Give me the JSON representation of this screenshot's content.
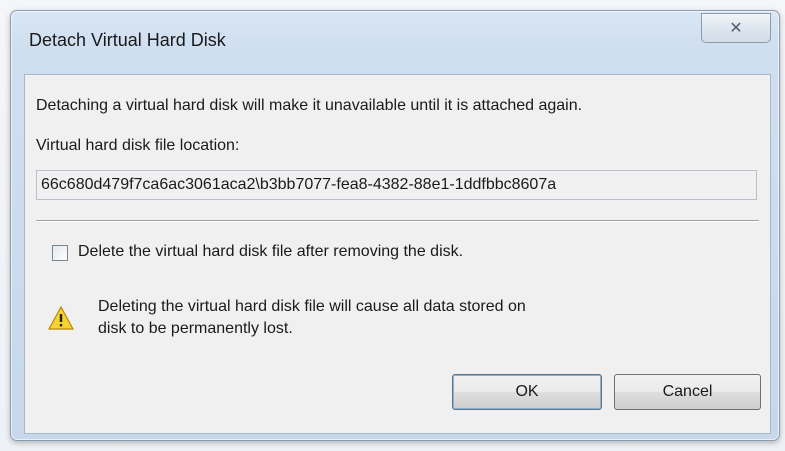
{
  "dialog": {
    "title": "Detach Virtual Hard Disk",
    "close_glyph": "✕"
  },
  "message": {
    "intro": "Detaching a virtual hard disk will make it unavailable until it is attached again.",
    "location_label": "Virtual hard disk file location:",
    "location_value": "66c680d479f7ca6ac3061aca2\\b3bb7077-fea8-4382-88e1-1ddfbbc8607a"
  },
  "delete_option": {
    "label": "Delete the virtual hard disk file after removing the disk.",
    "checked": false
  },
  "warning": {
    "line1": "Deleting the virtual hard disk file will cause all data stored on",
    "line2": "disk to be permanently lost.",
    "icon": "warning-triangle-icon"
  },
  "buttons": {
    "ok": "OK",
    "cancel": "Cancel"
  }
}
